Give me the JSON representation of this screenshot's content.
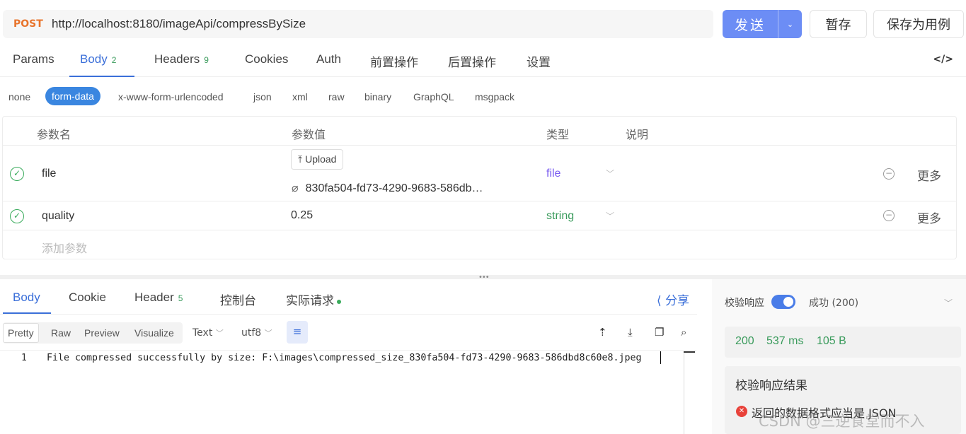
{
  "request": {
    "method": "POST",
    "url": "http://localhost:8180/imageApi/compressBySize",
    "send_label": "发送",
    "save_label": "暂存",
    "save_as_case_label": "保存为用例"
  },
  "request_tabs": [
    {
      "label": "Params",
      "count": ""
    },
    {
      "label": "Body",
      "count": "2"
    },
    {
      "label": "Headers",
      "count": "9"
    },
    {
      "label": "Cookies",
      "count": ""
    },
    {
      "label": "Auth",
      "count": ""
    },
    {
      "label": "前置操作",
      "count": ""
    },
    {
      "label": "后置操作",
      "count": ""
    },
    {
      "label": "设置",
      "count": ""
    }
  ],
  "code_icon_label": "</>",
  "body_types": [
    "none",
    "form-data",
    "x-www-form-urlencoded",
    "json",
    "xml",
    "raw",
    "binary",
    "GraphQL",
    "msgpack"
  ],
  "params_table": {
    "headers": [
      "参数名",
      "参数值",
      "类型",
      "说明"
    ],
    "rows": [
      {
        "name": "file",
        "upload_label": "Upload",
        "value": "830fa504-fd73-4290-9683-586db…",
        "type": "file",
        "more": "更多"
      },
      {
        "name": "quality",
        "value": "0.25",
        "type": "string",
        "more": "更多"
      }
    ],
    "add_placeholder": "添加参数"
  },
  "response_tabs": [
    {
      "label": "Body",
      "count": ""
    },
    {
      "label": "Cookie",
      "count": ""
    },
    {
      "label": "Header",
      "count": "5"
    },
    {
      "label": "控制台",
      "count": ""
    },
    {
      "label": "实际请求",
      "count": ""
    }
  ],
  "share_label": "分享",
  "view_modes": [
    "Pretty",
    "Raw",
    "Preview",
    "Visualize"
  ],
  "format_select": "Text",
  "encoding_select": "utf8",
  "response_body": {
    "line_number": "1",
    "text": "File compressed successfully by size: F:\\images\\compressed_size_830fa504-fd73-4290-9683-586dbd8c60e8.jpeg"
  },
  "validation": {
    "label": "校验响应",
    "status": "成功 (200)",
    "code": "200",
    "time": "537 ms",
    "size": "105 B",
    "result_title": "校验响应结果",
    "error_message": "返回的数据格式应当是 JSON"
  },
  "watermark": "CSDN @三逆食堂而不入",
  "colors": {
    "accent": "#3b6fd9",
    "send": "#6c8df5",
    "method": "#e8742c",
    "success": "#3a9b5c",
    "error": "#e8423a"
  }
}
